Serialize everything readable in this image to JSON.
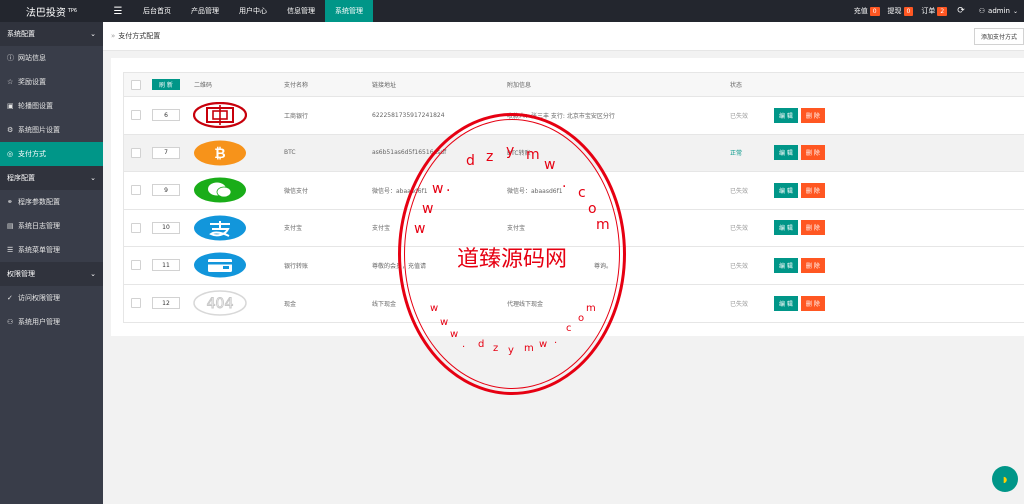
{
  "app": {
    "title": "法巴投资",
    "version": "TP6"
  },
  "topnav": {
    "tabs": [
      {
        "label": "后台首页"
      },
      {
        "label": "产品管理"
      },
      {
        "label": "用户中心"
      },
      {
        "label": "信息管理"
      },
      {
        "label": "系统管理"
      }
    ],
    "right": {
      "recharge_label": "充值",
      "recharge_count": "0",
      "withdraw_label": "提现",
      "withdraw_count": "0",
      "order_label": "订单",
      "order_count": "2",
      "user_name": "admin"
    }
  },
  "sidebar": {
    "group1": {
      "label": "系统配置"
    },
    "group1_items": [
      {
        "label": "网站信息",
        "icon": "info-icon"
      },
      {
        "label": "奖励设置",
        "icon": "star-icon"
      },
      {
        "label": "轮播图设置",
        "icon": "image-icon"
      },
      {
        "label": "系统图片设置",
        "icon": "gear-icon"
      },
      {
        "label": "支付方式",
        "icon": "target-icon"
      }
    ],
    "group2": {
      "label": "程序配置"
    },
    "group2_items": [
      {
        "label": "程序参数配置",
        "icon": "link-icon"
      },
      {
        "label": "系统日志管理",
        "icon": "doc-icon"
      },
      {
        "label": "系统菜单管理",
        "icon": "list-icon"
      }
    ],
    "group3": {
      "label": "权限管理"
    },
    "group3_items": [
      {
        "label": "访问权限管理",
        "icon": "check-icon"
      },
      {
        "label": "系统用户管理",
        "icon": "user-icon"
      }
    ]
  },
  "breadcrumb": {
    "text": "支付方式配置"
  },
  "toolbar": {
    "add_label": "添加支付方式"
  },
  "table": {
    "headers": {
      "refresh": "刷 新",
      "qr": "二维码",
      "name": "支付名称",
      "link": "链接地址",
      "extra": "附加信息",
      "status": "状态"
    },
    "edit_label": "编 辑",
    "delete_label": "删 除",
    "rows": [
      {
        "sort": "6",
        "qr": "icbc-logo",
        "name": "工商银行",
        "link": "6222581735917241824",
        "extra": "收款人：张三丰 支行: 北京市宝安区分行",
        "status": "已失效",
        "active": false
      },
      {
        "sort": "7",
        "qr": "bitcoin-logo",
        "name": "BTC",
        "link": "as6b51as6d5f16516asdf",
        "extra": "BTC转账",
        "status": "正常",
        "active": true
      },
      {
        "sort": "9",
        "qr": "wechat-logo",
        "name": "微信支付",
        "link": "微信号：abaasd6f1",
        "extra": "微信号：abaasd6f1",
        "status": "已失效",
        "active": false
      },
      {
        "sort": "10",
        "qr": "alipay-logo",
        "name": "支付宝",
        "link": "支付宝",
        "extra": "支付宝",
        "status": "已失效",
        "active": false
      },
      {
        "sort": "11",
        "qr": "bank-card-logo",
        "name": "银行转账",
        "link": "尊敬的会员，充值请",
        "extra": "尊询。",
        "status": "已失效",
        "active": false
      },
      {
        "sort": "12",
        "qr": "404-image",
        "name": "现金",
        "link": "线下现金",
        "extra": "代理线下现金",
        "status": "已失效",
        "active": false
      }
    ]
  },
  "watermark": {
    "center_text": "道臻源码网",
    "url_chars": [
      "w",
      "w",
      "w",
      ".",
      "d",
      "z",
      "y",
      "m",
      "w",
      ".",
      "c",
      "o",
      "m"
    ]
  }
}
